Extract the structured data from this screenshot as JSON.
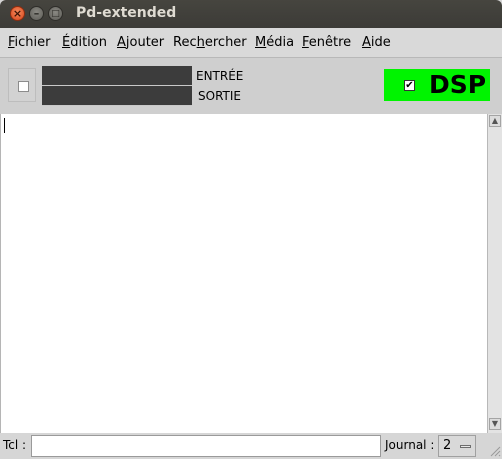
{
  "window": {
    "title": "Pd-extended",
    "buttons": {
      "close": "×",
      "minimize": "–",
      "maximize": "□"
    }
  },
  "menubar": {
    "items": [
      {
        "pre": "",
        "ul": "F",
        "post": "ichier"
      },
      {
        "pre": "",
        "ul": "É",
        "post": "dition"
      },
      {
        "pre": "",
        "ul": "A",
        "post": "jouter"
      },
      {
        "pre": "Rec",
        "ul": "h",
        "post": "ercher"
      },
      {
        "pre": "",
        "ul": "M",
        "post": "édia"
      },
      {
        "pre": "",
        "ul": "F",
        "post": "enêtre"
      },
      {
        "pre": "",
        "ul": "A",
        "post": "ide"
      }
    ]
  },
  "toolbar": {
    "input_label": "ENTRÉE",
    "output_label": "SORTIE",
    "dsp_label": "DSP",
    "dsp_checked": true,
    "dsp_color": "#00f400",
    "meter_color": "#3c3c3c"
  },
  "console": {
    "text": ""
  },
  "bottom": {
    "tcl_label": "Tcl :",
    "tcl_value": "",
    "journal_label": "Journal :",
    "journal_value": "2"
  }
}
